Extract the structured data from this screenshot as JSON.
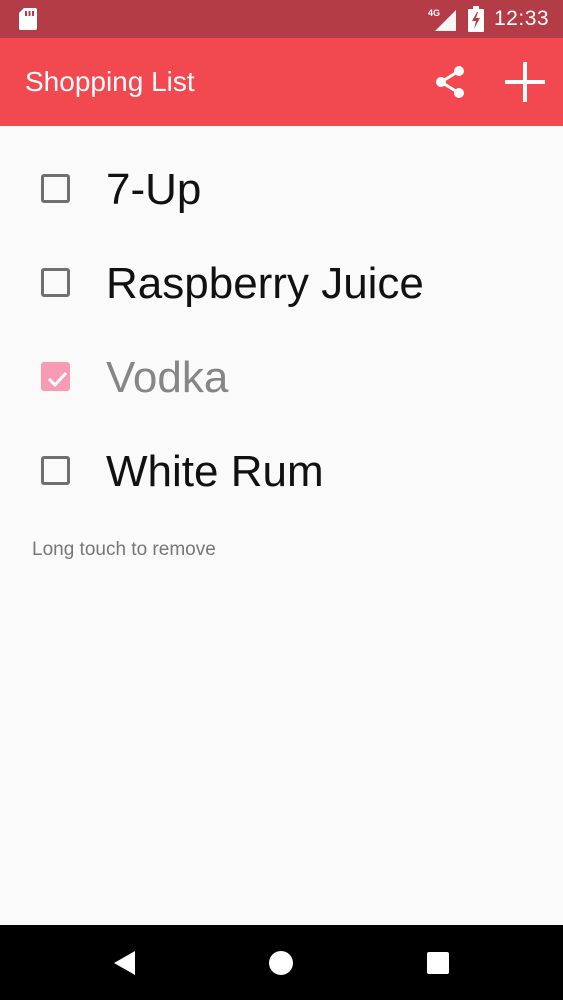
{
  "status_bar": {
    "network_label": "4G",
    "time": "12:33",
    "icons": [
      "sd-card-icon",
      "cell-signal-icon",
      "battery-charging-icon"
    ]
  },
  "app_bar": {
    "title": "Shopping List",
    "background": "#f2484f",
    "actions": [
      "share-icon",
      "add-icon"
    ]
  },
  "items": [
    {
      "label": "7-Up",
      "checked": false
    },
    {
      "label": "Raspberry Juice",
      "checked": false
    },
    {
      "label": "Vodka",
      "checked": true
    },
    {
      "label": "White Rum",
      "checked": false
    }
  ],
  "hint": "Long touch to remove",
  "nav_bar": {
    "buttons": [
      "back-icon",
      "home-icon",
      "recents-icon"
    ]
  },
  "colors": {
    "status_bar": "#b43c46",
    "checkbox_checked": "#f79ab3",
    "checked_text": "#868686"
  }
}
